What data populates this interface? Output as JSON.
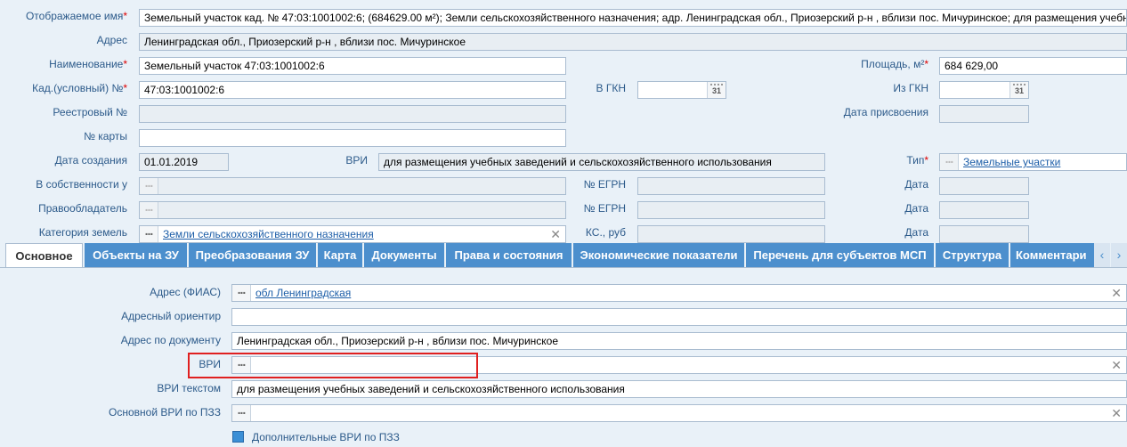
{
  "header": {
    "display_name": {
      "label": "Отображаемое имя",
      "value": "Земельный участок  кад. № 47:03:1001002:6; (684629.00 м²); Земли сельскохозяйственного назначения; адр. Ленинградская обл., Приозерский р-н , вблизи пос. Мичуринское; для размещения учебных"
    },
    "address": {
      "label": "Адрес",
      "value": "Ленинградская обл., Приозерский р-н , вблизи пос. Мичуринское"
    },
    "name": {
      "label": "Наименование",
      "value": "Земельный участок 47:03:1001002:6"
    },
    "area": {
      "label": "Площадь, м²",
      "value": "684 629,00"
    },
    "cad_number": {
      "label": "Кад.(условный) №",
      "value": "47:03:1001002:6"
    },
    "v_gkn": {
      "label": "В ГКН",
      "value": ""
    },
    "iz_gkn": {
      "label": "Из ГКН",
      "value": ""
    },
    "registry_number": {
      "label": "Реестровый №",
      "value": ""
    },
    "assign_date": {
      "label": "Дата присвоения",
      "value": ""
    },
    "card_number": {
      "label": "№ карты",
      "value": ""
    },
    "created_date": {
      "label": "Дата создания",
      "value": "01.01.2019"
    },
    "vri": {
      "label": "ВРИ",
      "value": "для размещения учебных заведений и сельскохозяйственного использования"
    },
    "type": {
      "label": "Тип",
      "value": "Земельные участки"
    },
    "owned_by": {
      "label": "В собственности у",
      "value": ""
    },
    "egrn1": {
      "label": "№ ЕГРН",
      "value": ""
    },
    "date1": {
      "label": "Дата",
      "value": ""
    },
    "rights_holder": {
      "label": "Правообладатель",
      "value": ""
    },
    "egrn2": {
      "label": "№ ЕГРН",
      "value": ""
    },
    "date2": {
      "label": "Дата",
      "value": ""
    },
    "land_category": {
      "label": "Категория земель",
      "value": "Земли сельскохозяйственного назначения"
    },
    "ks": {
      "label": "КС., руб",
      "value": ""
    },
    "date3": {
      "label": "Дата",
      "value": ""
    },
    "calendar_icon_text": "31",
    "dots_text": "...",
    "clear_icon_text": "✕"
  },
  "tabs": [
    "Основное",
    "Объекты на ЗУ",
    "Преобразования ЗУ",
    "Карта",
    "Документы",
    "Права и состояния",
    "Экономические показатели",
    "Перечень для субъектов МСП",
    "Структура",
    "Комментари"
  ],
  "tab_arrows": {
    "left": "‹",
    "right": "›"
  },
  "main": {
    "address_fias": {
      "label": "Адрес (ФИАС)",
      "value": "обл Ленинградская"
    },
    "address_landmark": {
      "label": "Адресный ориентир",
      "value": ""
    },
    "address_doc": {
      "label": "Адрес по документу",
      "value": "Ленинградская обл., Приозерский р-н , вблизи пос. Мичуринское"
    },
    "vri": {
      "label": "ВРИ",
      "value": ""
    },
    "vri_text": {
      "label": "ВРИ текстом",
      "value": "для размещения учебных заведений и сельскохозяйственного использования"
    },
    "main_vri_pzz": {
      "label": "Основной ВРИ по ПЗЗ",
      "value": ""
    },
    "extra_vri_pzz": {
      "label": "Дополнительные ВРИ по ПЗЗ"
    }
  }
}
